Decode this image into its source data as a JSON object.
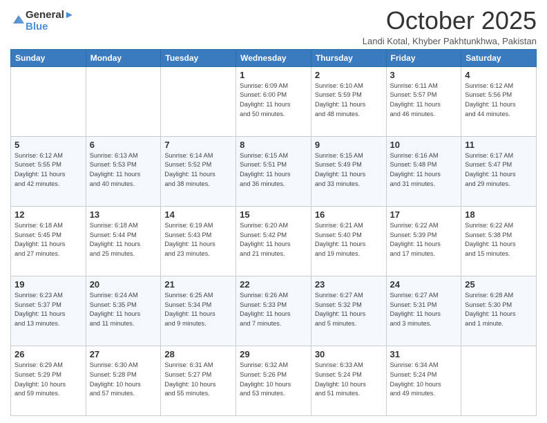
{
  "logo": {
    "line1": "General",
    "line2": "Blue"
  },
  "title": "October 2025",
  "subtitle": "Landi Kotal, Khyber Pakhtunkhwa, Pakistan",
  "days_of_week": [
    "Sunday",
    "Monday",
    "Tuesday",
    "Wednesday",
    "Thursday",
    "Friday",
    "Saturday"
  ],
  "weeks": [
    [
      {
        "day": "",
        "info": ""
      },
      {
        "day": "",
        "info": ""
      },
      {
        "day": "",
        "info": ""
      },
      {
        "day": "1",
        "info": "Sunrise: 6:09 AM\nSunset: 6:00 PM\nDaylight: 11 hours\nand 50 minutes."
      },
      {
        "day": "2",
        "info": "Sunrise: 6:10 AM\nSunset: 5:59 PM\nDaylight: 11 hours\nand 48 minutes."
      },
      {
        "day": "3",
        "info": "Sunrise: 6:11 AM\nSunset: 5:57 PM\nDaylight: 11 hours\nand 46 minutes."
      },
      {
        "day": "4",
        "info": "Sunrise: 6:12 AM\nSunset: 5:56 PM\nDaylight: 11 hours\nand 44 minutes."
      }
    ],
    [
      {
        "day": "5",
        "info": "Sunrise: 6:12 AM\nSunset: 5:55 PM\nDaylight: 11 hours\nand 42 minutes."
      },
      {
        "day": "6",
        "info": "Sunrise: 6:13 AM\nSunset: 5:53 PM\nDaylight: 11 hours\nand 40 minutes."
      },
      {
        "day": "7",
        "info": "Sunrise: 6:14 AM\nSunset: 5:52 PM\nDaylight: 11 hours\nand 38 minutes."
      },
      {
        "day": "8",
        "info": "Sunrise: 6:15 AM\nSunset: 5:51 PM\nDaylight: 11 hours\nand 36 minutes."
      },
      {
        "day": "9",
        "info": "Sunrise: 6:15 AM\nSunset: 5:49 PM\nDaylight: 11 hours\nand 33 minutes."
      },
      {
        "day": "10",
        "info": "Sunrise: 6:16 AM\nSunset: 5:48 PM\nDaylight: 11 hours\nand 31 minutes."
      },
      {
        "day": "11",
        "info": "Sunrise: 6:17 AM\nSunset: 5:47 PM\nDaylight: 11 hours\nand 29 minutes."
      }
    ],
    [
      {
        "day": "12",
        "info": "Sunrise: 6:18 AM\nSunset: 5:45 PM\nDaylight: 11 hours\nand 27 minutes."
      },
      {
        "day": "13",
        "info": "Sunrise: 6:18 AM\nSunset: 5:44 PM\nDaylight: 11 hours\nand 25 minutes."
      },
      {
        "day": "14",
        "info": "Sunrise: 6:19 AM\nSunset: 5:43 PM\nDaylight: 11 hours\nand 23 minutes."
      },
      {
        "day": "15",
        "info": "Sunrise: 6:20 AM\nSunset: 5:42 PM\nDaylight: 11 hours\nand 21 minutes."
      },
      {
        "day": "16",
        "info": "Sunrise: 6:21 AM\nSunset: 5:40 PM\nDaylight: 11 hours\nand 19 minutes."
      },
      {
        "day": "17",
        "info": "Sunrise: 6:22 AM\nSunset: 5:39 PM\nDaylight: 11 hours\nand 17 minutes."
      },
      {
        "day": "18",
        "info": "Sunrise: 6:22 AM\nSunset: 5:38 PM\nDaylight: 11 hours\nand 15 minutes."
      }
    ],
    [
      {
        "day": "19",
        "info": "Sunrise: 6:23 AM\nSunset: 5:37 PM\nDaylight: 11 hours\nand 13 minutes."
      },
      {
        "day": "20",
        "info": "Sunrise: 6:24 AM\nSunset: 5:35 PM\nDaylight: 11 hours\nand 11 minutes."
      },
      {
        "day": "21",
        "info": "Sunrise: 6:25 AM\nSunset: 5:34 PM\nDaylight: 11 hours\nand 9 minutes."
      },
      {
        "day": "22",
        "info": "Sunrise: 6:26 AM\nSunset: 5:33 PM\nDaylight: 11 hours\nand 7 minutes."
      },
      {
        "day": "23",
        "info": "Sunrise: 6:27 AM\nSunset: 5:32 PM\nDaylight: 11 hours\nand 5 minutes."
      },
      {
        "day": "24",
        "info": "Sunrise: 6:27 AM\nSunset: 5:31 PM\nDaylight: 11 hours\nand 3 minutes."
      },
      {
        "day": "25",
        "info": "Sunrise: 6:28 AM\nSunset: 5:30 PM\nDaylight: 11 hours\nand 1 minute."
      }
    ],
    [
      {
        "day": "26",
        "info": "Sunrise: 6:29 AM\nSunset: 5:29 PM\nDaylight: 10 hours\nand 59 minutes."
      },
      {
        "day": "27",
        "info": "Sunrise: 6:30 AM\nSunset: 5:28 PM\nDaylight: 10 hours\nand 57 minutes."
      },
      {
        "day": "28",
        "info": "Sunrise: 6:31 AM\nSunset: 5:27 PM\nDaylight: 10 hours\nand 55 minutes."
      },
      {
        "day": "29",
        "info": "Sunrise: 6:32 AM\nSunset: 5:26 PM\nDaylight: 10 hours\nand 53 minutes."
      },
      {
        "day": "30",
        "info": "Sunrise: 6:33 AM\nSunset: 5:24 PM\nDaylight: 10 hours\nand 51 minutes."
      },
      {
        "day": "31",
        "info": "Sunrise: 6:34 AM\nSunset: 5:24 PM\nDaylight: 10 hours\nand 49 minutes."
      },
      {
        "day": "",
        "info": ""
      }
    ]
  ]
}
